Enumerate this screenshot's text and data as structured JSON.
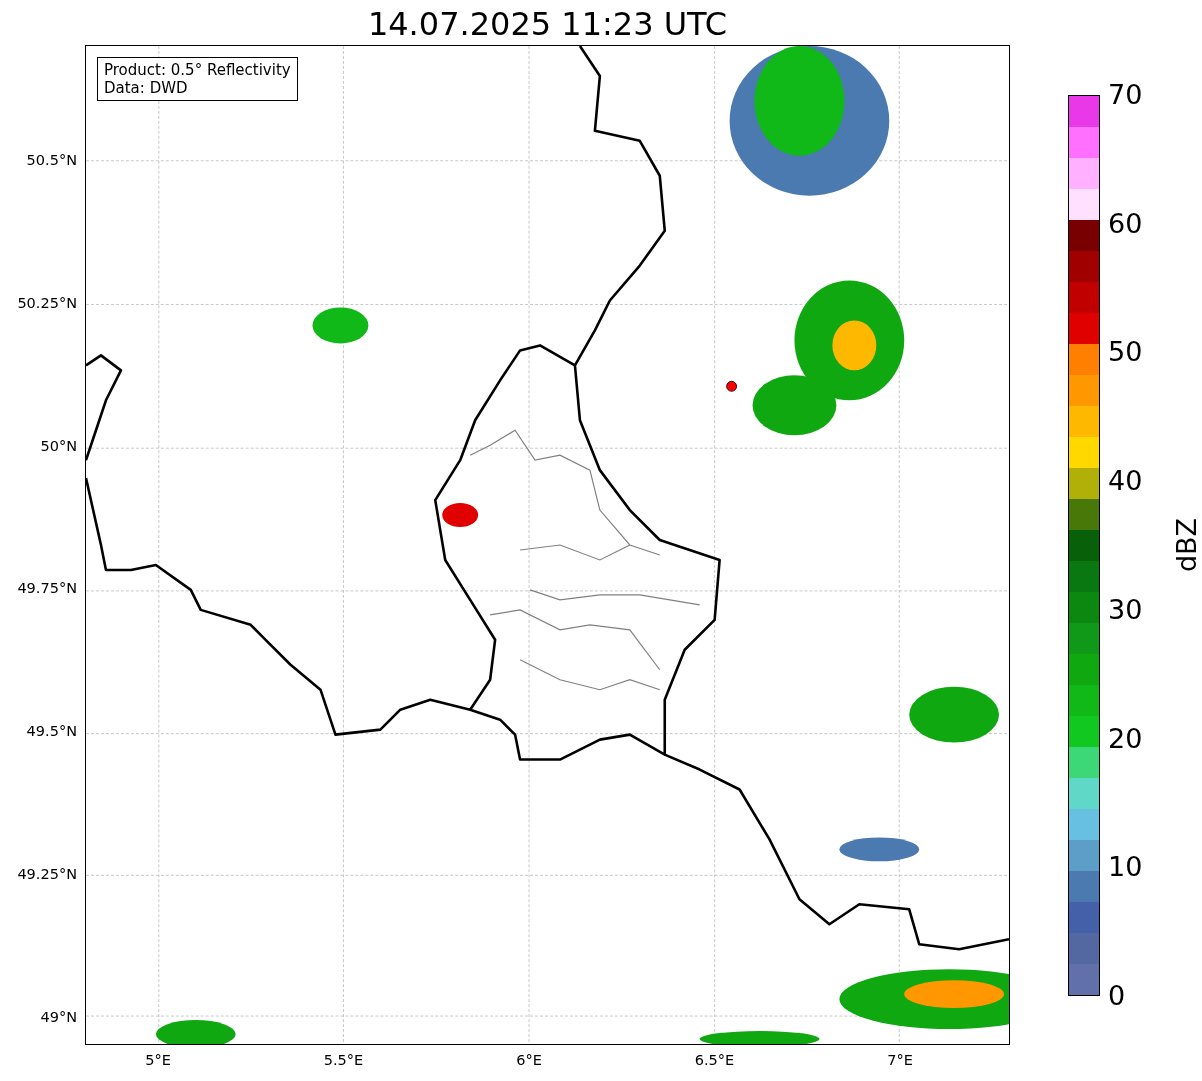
{
  "title": "14.07.2025 11:23 UTC",
  "map": {
    "legend": [
      "Product: 0.5° Reflectivity",
      "Data: DWD"
    ],
    "lat_labels": [
      "50.5°N",
      "50.25°N",
      "50°N",
      "49.75°N",
      "49.5°N",
      "49.25°N",
      "49°N"
    ],
    "lon_labels": [
      "5°E",
      "5.5°E",
      "6°E",
      "6.5°E",
      "7°E"
    ]
  },
  "colorbar": {
    "label": "dBZ",
    "ticks": [
      "70",
      "60",
      "50",
      "40",
      "30",
      "20",
      "10",
      "0"
    ],
    "bins": [
      {
        "color": "#e838e8"
      },
      {
        "color": "#ff70ff"
      },
      {
        "color": "#ffb0ff"
      },
      {
        "color": "#ffe0ff"
      },
      {
        "color": "#780000"
      },
      {
        "color": "#a00000"
      },
      {
        "color": "#c00000"
      },
      {
        "color": "#e00000"
      },
      {
        "color": "#ff8000"
      },
      {
        "color": "#ff9800"
      },
      {
        "color": "#ffb800"
      },
      {
        "color": "#ffd800"
      },
      {
        "color": "#b0b008"
      },
      {
        "color": "#487808"
      },
      {
        "color": "#086008"
      },
      {
        "color": "#0a7810"
      },
      {
        "color": "#0c8810"
      },
      {
        "color": "#109818"
      },
      {
        "color": "#10a810"
      },
      {
        "color": "#10b818"
      },
      {
        "color": "#10c820"
      },
      {
        "color": "#3cd878"
      },
      {
        "color": "#60d8c8"
      },
      {
        "color": "#68c0e0"
      },
      {
        "color": "#5c9ec8"
      },
      {
        "color": "#4a7ab0"
      },
      {
        "color": "#4460a8"
      },
      {
        "color": "#5368a0"
      },
      {
        "color": "#6170a8"
      }
    ]
  }
}
